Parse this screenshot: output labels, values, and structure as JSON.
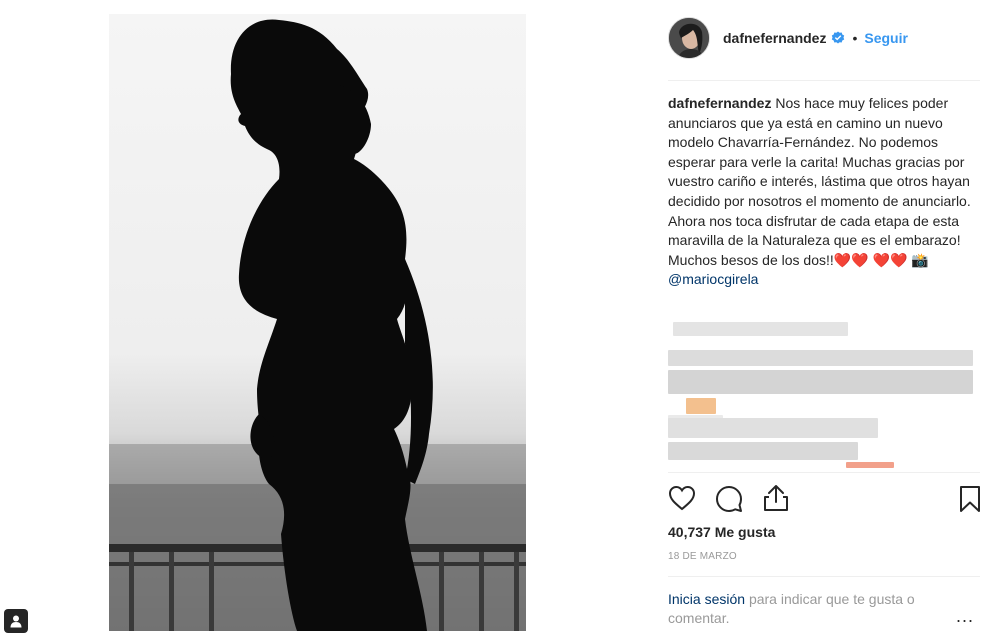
{
  "post": {
    "username": "dafnefernandez",
    "follow_label": "Seguir",
    "separator": "•",
    "caption": {
      "username": "dafnefernandez",
      "text": "Nos hace muy felices poder anunciaros que ya está en camino un nuevo modelo Chavarría-Fernández. No podemos esperar para verle la carita! Muchas gracias por vuestro cariño e interés, lástima que otros hayan decidido por nosotros el momento de anunciarlo. Ahora nos toca disfrutar de cada etapa de esta maravilla de la Naturaleza que es el embarazo! Muchos besos de los dos!!",
      "hearts_inline": "❤️❤️",
      "hearts_line2": "❤️❤️",
      "camera_emoji": "📸",
      "mention": "@mariocgirela"
    },
    "likes_count": "40,737",
    "likes_label": "Me gusta",
    "date": "18 de marzo",
    "login": {
      "link": "Inicia sesión",
      "text": "para indicar que te gusta o comentar."
    },
    "more_label": "..."
  },
  "icons": {
    "user_tag": "user-tag-icon",
    "verified": "verified-badge-icon",
    "like": "heart-icon",
    "comment": "comment-icon",
    "share": "share-icon",
    "save": "bookmark-icon"
  },
  "colors": {
    "link_blue": "#3897f0",
    "mention_navy": "#003569",
    "text": "#262626",
    "muted": "#999999",
    "divider": "#efefef"
  }
}
